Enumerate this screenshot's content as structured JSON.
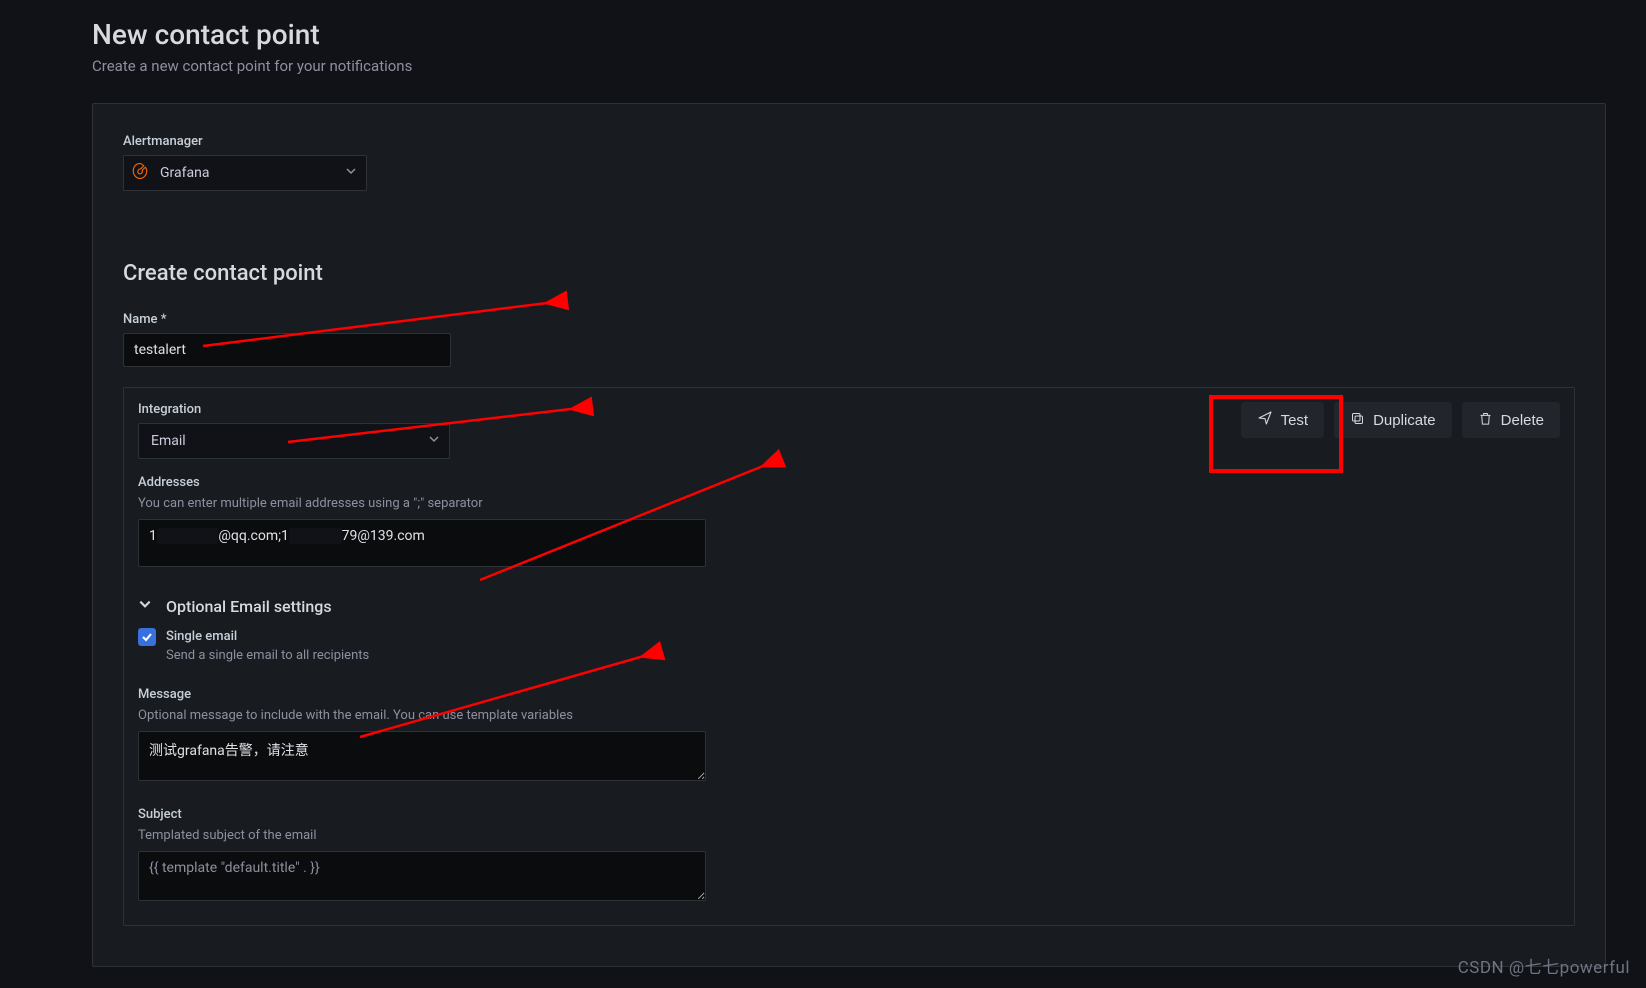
{
  "page": {
    "title": "New contact point",
    "subtitle": "Create a new contact point for your notifications"
  },
  "alertmanager": {
    "label": "Alertmanager",
    "value": "Grafana"
  },
  "section_title": "Create contact point",
  "name": {
    "label": "Name *",
    "value": "testalert"
  },
  "integration": {
    "label": "Integration",
    "value": "Email"
  },
  "addresses": {
    "label": "Addresses",
    "help": "You can enter multiple email addresses using a \";\" separator",
    "value_prefix": "1",
    "value_mid1": "@qq.com;1",
    "value_mid2": "79@139.com"
  },
  "optional": {
    "title": "Optional Email settings",
    "single_label": "Single email",
    "single_help": "Send a single email to all recipients"
  },
  "message": {
    "label": "Message",
    "help": "Optional message to include with the email. You can use template variables",
    "value": "测试grafana告警，请注意"
  },
  "subject": {
    "label": "Subject",
    "help": "Templated subject of the email",
    "value": "{{ template \"default.title\" . }}"
  },
  "buttons": {
    "test": "Test",
    "duplicate": "Duplicate",
    "delete": "Delete"
  },
  "watermark": "CSDN @七七powerful"
}
